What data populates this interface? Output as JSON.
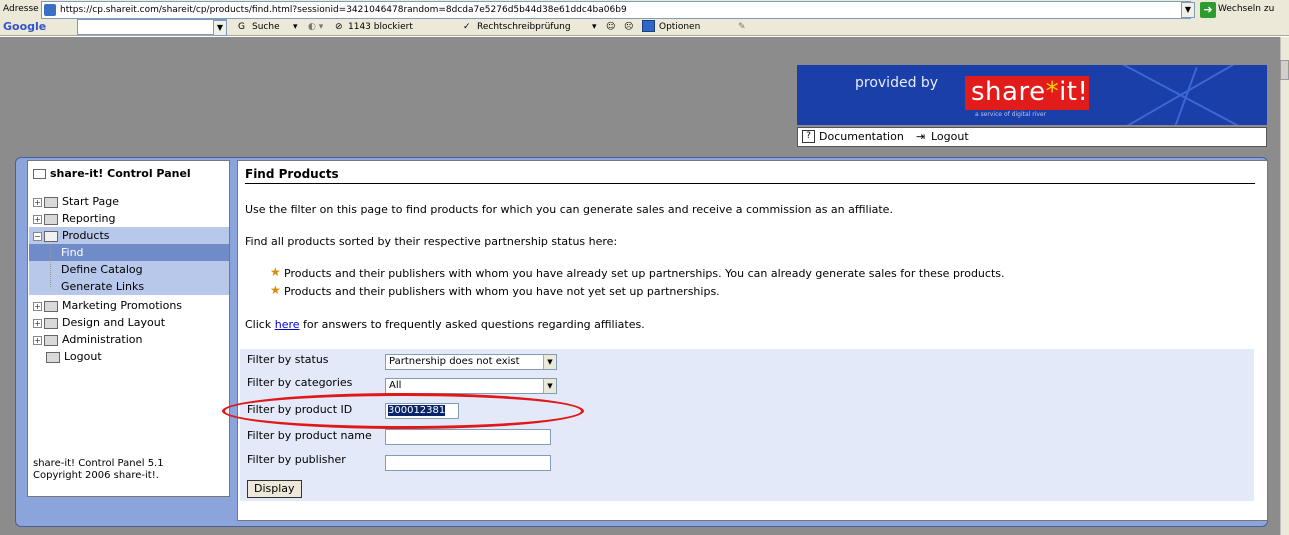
{
  "browser": {
    "address_label": "Adresse",
    "url": "https://cp.shareit.com/shareit/cp/products/find.html?sessionid=3421046478random=8dcda7e5276d5b44d38e61ddc4ba06b9",
    "go_label": "Wechseln zu",
    "toolbar": {
      "google_label": "Google",
      "search_label": "Suche",
      "blocked_label": "1143 blockiert",
      "spellcheck_label": "Rechtschreibprüfung",
      "options_label": "Optionen"
    }
  },
  "banner": {
    "provided_by": "provided by",
    "brand_part1": "share",
    "brand_star": "*",
    "brand_part2": "it!",
    "tagline": "a service of digital river",
    "documentation_label": "Documentation",
    "logout_label": "Logout"
  },
  "sidebar": {
    "title": "share-it! Control Panel",
    "items": [
      {
        "label": "Start Page"
      },
      {
        "label": "Reporting"
      },
      {
        "label": "Products"
      },
      {
        "label": "Find"
      },
      {
        "label": "Define Catalog"
      },
      {
        "label": "Generate Links"
      },
      {
        "label": "Marketing Promotions"
      },
      {
        "label": "Design and Layout"
      },
      {
        "label": "Administration"
      },
      {
        "label": "Logout"
      }
    ],
    "footer_line1": "share-it! Control Panel 5.1",
    "footer_line2": "Copyright 2006 share-it!."
  },
  "main": {
    "title": "Find Products",
    "intro": "Use the filter on this page to find products for which you can generate sales and receive a commission as an affiliate.",
    "sorted": "Find all products sorted by their respective partnership status here:",
    "bullet1": "Products and their publishers with whom you have already set up partnerships. You can already generate sales for these products.",
    "bullet2": "Products and their publishers with whom you have not yet set up partnerships.",
    "click_prefix": "Click",
    "click_link": "here",
    "click_suffix": "for answers to frequently asked questions regarding affiliates."
  },
  "filter": {
    "status_label": "Filter by status",
    "status_value": "Partnership does not exist",
    "categories_label": "Filter by categories",
    "categories_value": "All",
    "product_id_label": "Filter by product ID",
    "product_id_value": "300012381",
    "product_name_label": "Filter by product name",
    "product_name_value": "",
    "publisher_label": "Filter by publisher",
    "publisher_value": "",
    "display_button": "Display"
  },
  "colors": {
    "frame": "#8ba4dc",
    "highlight": "#b8c8ea",
    "selected": "#6f8cc9",
    "filter_bg": "#e3e9f8",
    "annotation": "#e01818",
    "banner": "#1b3fa8",
    "brand_red": "#e21b1b"
  }
}
